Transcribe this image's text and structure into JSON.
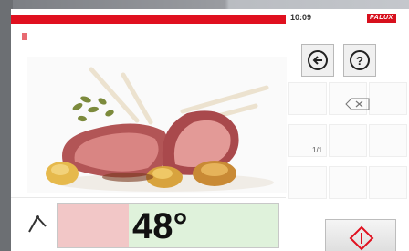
{
  "header": {
    "time": "10:09",
    "brand": "PALUX"
  },
  "main": {
    "image_description": "food photo",
    "temperature": "48°",
    "probe_icon": "core-probe-icon"
  },
  "right_panel": {
    "buttons": {
      "back_icon": "back-arrow-icon",
      "help_icon": "help-icon",
      "backspace_icon": "backspace-icon",
      "start_icon": "start-diamond-icon"
    },
    "page_indicator": "1/1"
  },
  "colors": {
    "accent_red": "#e0101f",
    "temp_bg": "#dff2db",
    "temp_fill": "#f2c7c7"
  }
}
